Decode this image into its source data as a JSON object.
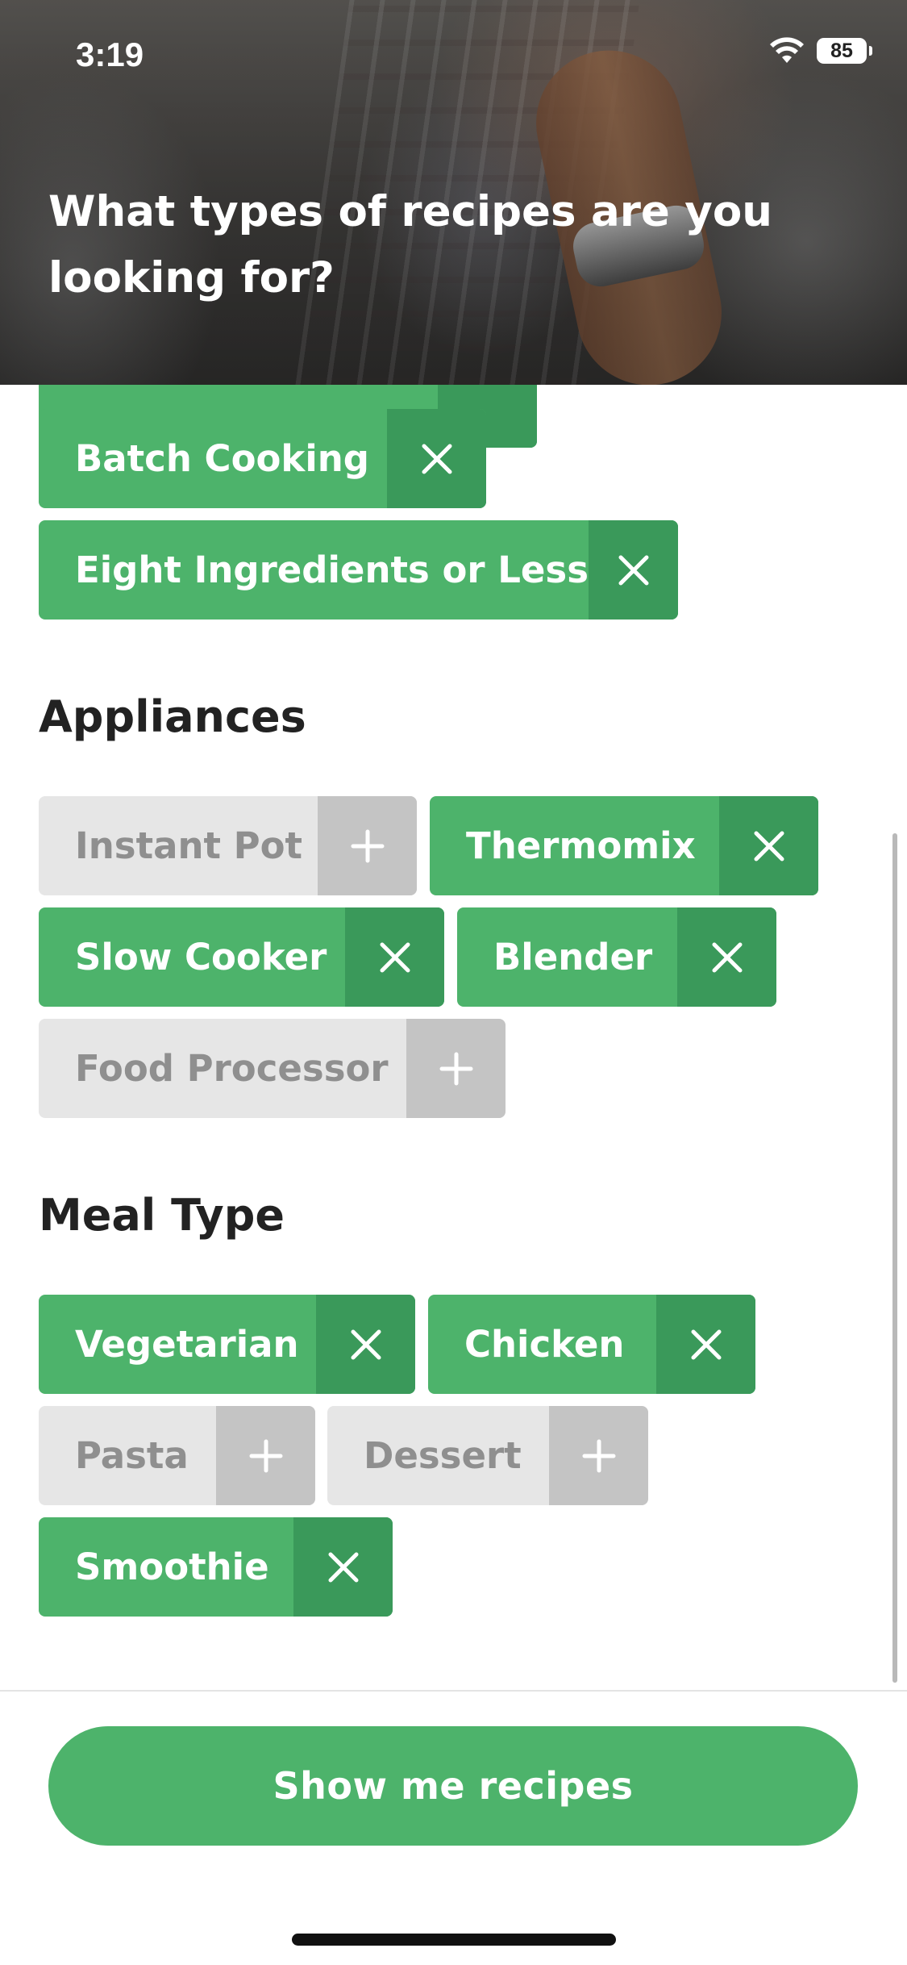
{
  "status_bar": {
    "time": "3:19",
    "battery": "85"
  },
  "header": {
    "title": "What types of recipes are you looking for?"
  },
  "sections": {
    "top": {
      "chips": [
        {
          "label": "Batch Cooking",
          "selected": true
        },
        {
          "label": "Eight Ingredients or Less",
          "selected": true
        }
      ]
    },
    "appliances": {
      "title": "Appliances",
      "chips": [
        {
          "label": "Instant Pot",
          "selected": false
        },
        {
          "label": "Thermomix",
          "selected": true
        },
        {
          "label": "Slow Cooker",
          "selected": true
        },
        {
          "label": "Blender",
          "selected": true
        },
        {
          "label": "Food Processor",
          "selected": false
        }
      ]
    },
    "meal_type": {
      "title": "Meal Type",
      "chips": [
        {
          "label": "Vegetarian",
          "selected": true
        },
        {
          "label": "Chicken",
          "selected": true
        },
        {
          "label": "Pasta",
          "selected": false
        },
        {
          "label": "Dessert",
          "selected": false
        },
        {
          "label": "Smoothie",
          "selected": true
        }
      ]
    }
  },
  "footer": {
    "cta_label": "Show me recipes"
  },
  "colors": {
    "accent": "#4db36b",
    "accent_dark": "#3a995a",
    "chip_off_bg": "#e6e6e6",
    "chip_off_action": "#c4c4c4",
    "chip_off_text": "#8f8f8f"
  },
  "icons": {
    "remove": "close-icon",
    "add": "plus-icon"
  }
}
